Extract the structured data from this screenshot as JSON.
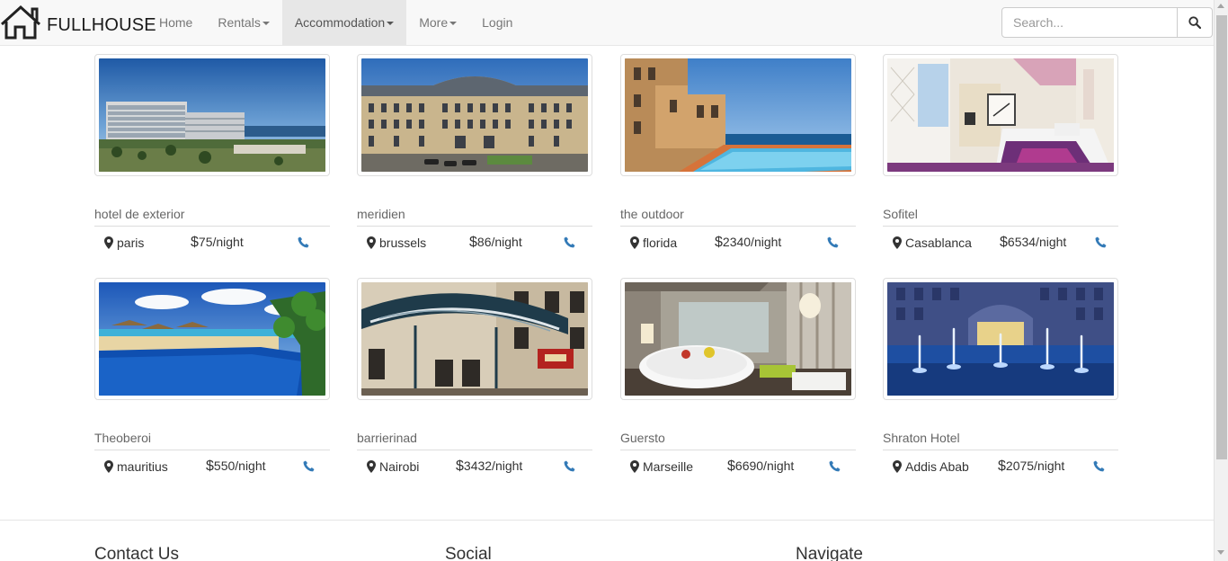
{
  "brand": {
    "name": "FULLHOUSE"
  },
  "nav": {
    "items": [
      {
        "label": "Home"
      },
      {
        "label": "Rentals"
      },
      {
        "label": "Accommodation"
      },
      {
        "label": "More"
      },
      {
        "label": "Login"
      }
    ]
  },
  "search": {
    "placeholder": "Search...",
    "value": ""
  },
  "listings": [
    {
      "name": "hotel de exterior",
      "city": "paris",
      "price_symbol": "$",
      "price": "75/night"
    },
    {
      "name": "meridien",
      "city": "brussels",
      "price_symbol": "$",
      "price": "86/night"
    },
    {
      "name": "the outdoor",
      "city": "florida",
      "price_symbol": "$",
      "price": "2340/night"
    },
    {
      "name": "Sofitel",
      "city": "Casablanca",
      "price_symbol": "$",
      "price": "6534/night"
    },
    {
      "name": "Theoberoi",
      "city": "mauritius",
      "price_symbol": "$",
      "price": "550/night"
    },
    {
      "name": "barrierinad",
      "city": "Nairobi",
      "price_symbol": "$",
      "price": "3432/night"
    },
    {
      "name": "Guersto",
      "city": "Marseille",
      "price_symbol": "$",
      "price": "6690/night"
    },
    {
      "name": "Shraton Hotel",
      "city": "Addis Abab",
      "price_symbol": "$",
      "price": "2075/night"
    }
  ],
  "footer": {
    "headings": [
      "Contact Us",
      "Social",
      "Navigate"
    ]
  },
  "colors": {
    "accent": "#337ab7",
    "navbar_bg": "#f8f8f8",
    "active_nav_bg": "#e7e7e7"
  },
  "icons": [
    "house-logo-icon",
    "search-icon",
    "map-marker-icon",
    "phone-icon",
    "caret-down-icon"
  ]
}
